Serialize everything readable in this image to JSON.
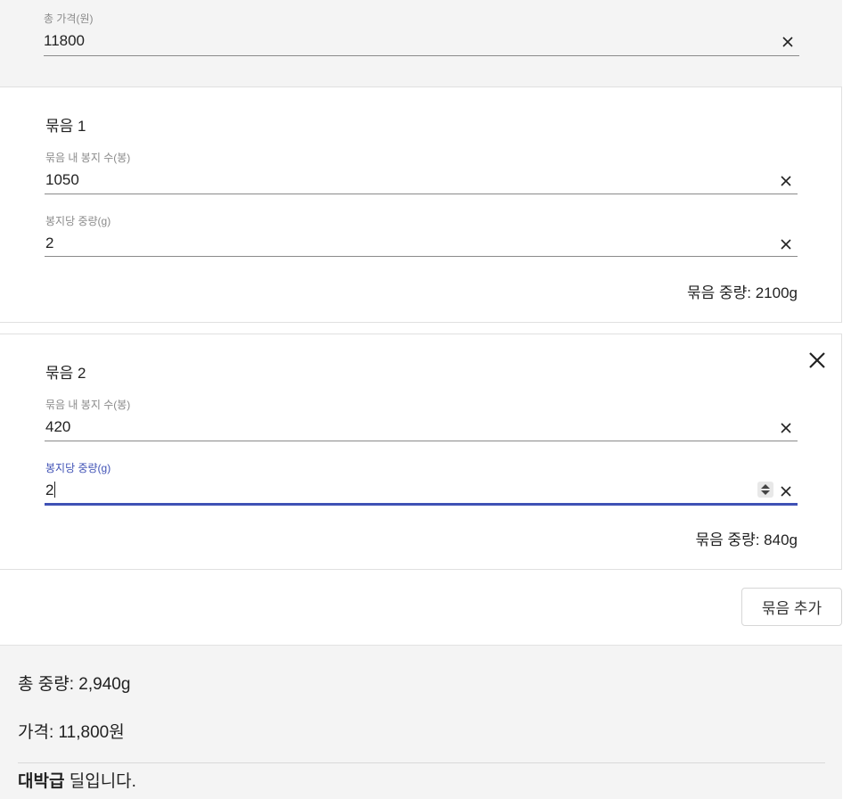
{
  "total_price": {
    "label": "총 가격(원)",
    "value": "11800"
  },
  "bundles": [
    {
      "title": "묶음 1",
      "count_label": "묶음 내 봉지 수(봉)",
      "count_value": "1050",
      "weight_label": "봉지당 중량(g)",
      "weight_value": "2",
      "bundle_weight": "묶음 중량: 2100g"
    },
    {
      "title": "묶음 2",
      "count_label": "묶음 내 봉지 수(봉)",
      "count_value": "420",
      "weight_label": "봉지당 중량(g)",
      "weight_value": "2",
      "bundle_weight": "묶음 중량: 840g"
    }
  ],
  "add_bundle_label": "묶음 추가",
  "summary": {
    "total_weight": "총 중량: 2,940g",
    "price": "가격: 11,800원",
    "verdict_bold": "대박급",
    "verdict_rest": " 딜입니다."
  },
  "colors": {
    "accent": "#3f51b5",
    "panel_bg": "#f4f4f4"
  },
  "icons": {
    "clear": "close-icon",
    "remove_bundle": "close-icon",
    "number_spinner": "spinner-icon"
  }
}
